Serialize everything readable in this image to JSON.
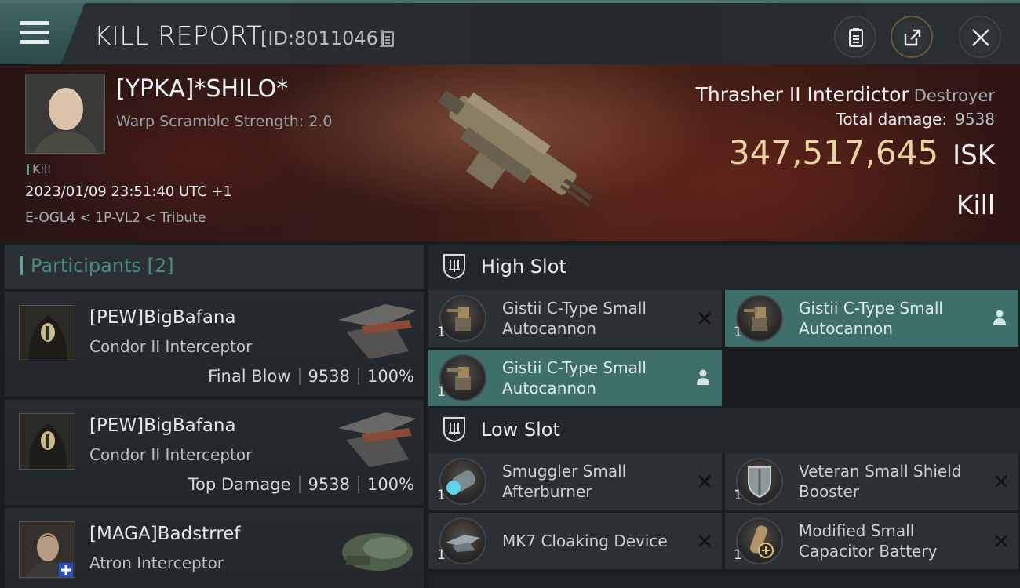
{
  "header": {
    "title": "KILL REPORT",
    "report_id": "[ID:8011046]"
  },
  "victim": {
    "name": "[YPKA]*SHILO*",
    "subtitle": "Warp Scramble Strength: 2.0",
    "tag": "Kill",
    "datetime": "2023/01/09 23:51:40 UTC +1",
    "location": "E-OGL4 < 1P-VL2 < Tribute",
    "ship": "Thrasher II Interdictor",
    "ship_class": "Destroyer",
    "total_damage_label": "Total damage:",
    "total_damage": "9538",
    "isk_value": "347,517,645",
    "isk_unit": "ISK",
    "type": "Kill"
  },
  "participants": {
    "label": "Participants",
    "count": "[2]",
    "rows": [
      {
        "name": "[PEW]BigBafana",
        "ship": "Condor II Interceptor",
        "role": "Final Blow",
        "damage": "9538",
        "percent": "100%"
      },
      {
        "name": "[PEW]BigBafana",
        "ship": "Condor II Interceptor",
        "role": "Top Damage",
        "damage": "9538",
        "percent": "100%"
      },
      {
        "name": "[MAGA]Badstrref",
        "ship": "Atron Interceptor"
      }
    ]
  },
  "slots": {
    "high": {
      "label": "High Slot",
      "modules": [
        {
          "name": "Gistii C-Type Small Autocannon",
          "qty": "1",
          "state": "destroyed",
          "icon": "autocannon-icon"
        },
        {
          "name": "Gistii C-Type Small Autocannon",
          "qty": "1",
          "state": "dropped",
          "icon": "autocannon-icon"
        },
        {
          "name": "Gistii C-Type Small Autocannon",
          "qty": "1",
          "state": "dropped",
          "icon": "autocannon-icon"
        }
      ]
    },
    "low": {
      "label": "Low Slot",
      "modules": [
        {
          "name": "Smuggler Small Afterburner",
          "qty": "1",
          "state": "destroyed",
          "icon": "afterburner-icon"
        },
        {
          "name": "Veteran Small Shield Booster",
          "qty": "1",
          "state": "destroyed",
          "icon": "shield-booster-icon"
        },
        {
          "name": "MK7 Cloaking Device",
          "qty": "1",
          "state": "destroyed",
          "icon": "cloaking-device-icon"
        },
        {
          "name": "Modified Small Capacitor Battery",
          "qty": "1",
          "state": "destroyed",
          "icon": "capacitor-battery-icon"
        }
      ]
    }
  },
  "colors": {
    "accent": "#4d8a85",
    "highlight": "#3f6f6a",
    "isk": "#e9d3a0"
  }
}
